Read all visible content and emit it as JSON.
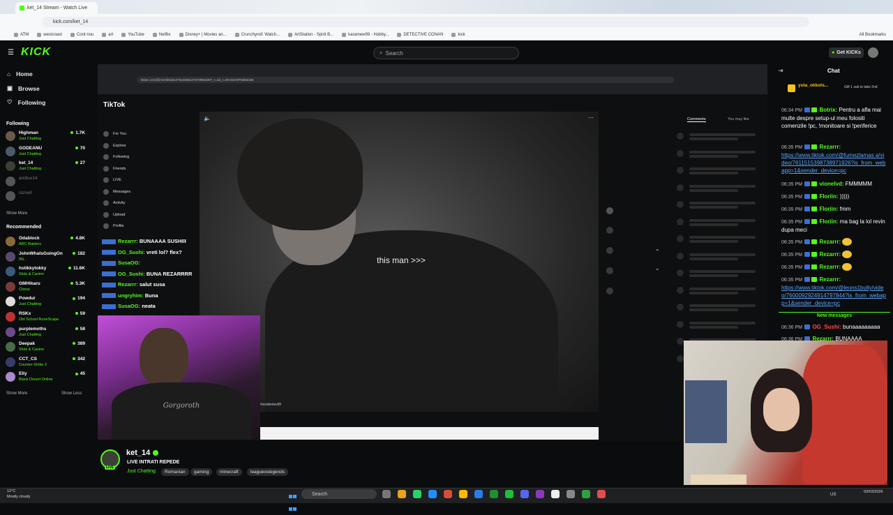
{
  "browser": {
    "tab_title": "ket_14 Stream - Watch Live",
    "url": "kick.com/ket_14",
    "bookmarks": [
      "ATM",
      "westcoast",
      "Cont nou",
      "art",
      "YouTube",
      "Netflix",
      "Disney+ | Movies an...",
      "Crunchyroll: Watch...",
      "ArtStation - Spirit B...",
      "karamew99 - Hobby...",
      "DETECTIVE CONAN",
      "kick"
    ],
    "all_bookmarks": "All Bookmarks"
  },
  "header": {
    "logo": "KICK",
    "search_placeholder": "Search",
    "get_kicks": "Get KICKs"
  },
  "sidebar": {
    "nav": [
      "Home",
      "Browse",
      "Following"
    ],
    "following_title": "Following",
    "following": [
      {
        "name": "Highman",
        "category": "Just Chatting",
        "viewers": "1.7K"
      },
      {
        "name": "GODEANU",
        "category": "Just Chatting",
        "viewers": "70"
      },
      {
        "name": "ket_14",
        "category": "Just Chatting",
        "viewers": "27"
      },
      {
        "name": "andiuu14",
        "category": "",
        "viewers": ""
      },
      {
        "name": "razvell",
        "category": "",
        "viewers": ""
      }
    ],
    "show_more_1": "Show More",
    "recommended_title": "Recommended",
    "recommended": [
      {
        "name": "Odablock",
        "category": "ARC Raiders",
        "viewers": "4.8K"
      },
      {
        "name": "JohnWhatsGoingOn",
        "category": "IRL",
        "viewers": "182"
      },
      {
        "name": "hstikkytokky",
        "category": "Slots & Casino",
        "viewers": "11.6K"
      },
      {
        "name": "GMHikaru",
        "category": "Chess",
        "viewers": "5.3K"
      },
      {
        "name": "Powdur",
        "category": "Just Chatting",
        "viewers": "194"
      },
      {
        "name": "RSKx",
        "category": "Old School RuneScape",
        "viewers": "59"
      },
      {
        "name": "purplemoths",
        "category": "Just Chatting",
        "viewers": "58"
      },
      {
        "name": "Deepak",
        "category": "Slots & Casino",
        "viewers": "389"
      },
      {
        "name": "CCT_CS",
        "category": "Counter-Strike 2",
        "viewers": "342"
      },
      {
        "name": "Elly",
        "category": "Black Desert Online",
        "viewers": "45"
      }
    ],
    "show_more_2": "Show More",
    "show_less": "Show Less"
  },
  "stream": {
    "inner_url": "tiktok.com/@irisrelli/video/7612658147579993109?_r=1&_t=ZN-94OSPNdk6cDE",
    "tiktok_logo": "TikTok",
    "tiktok_nav": [
      "For You",
      "Explore",
      "Following",
      "Friends",
      "LIVE",
      "Messages",
      "Activity",
      "Upload",
      "Profile"
    ],
    "caption": "this man >>>",
    "video_tag": "#residentevil9",
    "comments_tab": "Comments",
    "you_may_like": "You may like",
    "overlay_chat": [
      {
        "user": "Rezarrr:",
        "msg": "BUNAAAA SUSHIII"
      },
      {
        "user": "OG_Sushi:",
        "msg": "vreti lol? flex?"
      },
      {
        "user": "SusaOG:",
        "msg": ""
      },
      {
        "user": "OG_Sushi:",
        "msg": "BUNA REZARRRR"
      },
      {
        "user": "Rezarrr:",
        "msg": "salut susa"
      },
      {
        "user": "ungryhim:",
        "msg": "Buna"
      },
      {
        "user": "SusaOG:",
        "msg": "neata"
      }
    ],
    "cam_shirt": "Gorgoroth"
  },
  "stream_info": {
    "name": "ket_14",
    "title": "LIVE INTRATI REPEDE",
    "category": "Just Chatting",
    "tags": [
      "Romanian",
      "gaming",
      "minecraft",
      "leagueoslegends"
    ],
    "live_badge": "LIVE"
  },
  "chat": {
    "title": "Chat",
    "pinned_user": "yuta_okkots...",
    "pinned_text": "Gift 1 sub to take 2nd",
    "messages": [
      {
        "time": "06:34 PM",
        "user": "Botrix:",
        "text": "Pentru a afla mai multe despre setup-ul meu folositi comenzile !pc, !monitoare si !periferice",
        "link": "",
        "color": "#53fc18"
      },
      {
        "time": "06:35 PM",
        "user": "Rezarrr:",
        "text": "",
        "link": "https://www.tiktok.com/@fumezlamas a/video/7611515398738971926?is_from_webapp=1&sender_device=pc",
        "color": "#53fc18"
      },
      {
        "time": "06:35 PM",
        "user": "vionelvd:",
        "text": "FMMMMM",
        "link": "",
        "color": "#53fc18"
      },
      {
        "time": "06:35 PM",
        "user": "Floriin:",
        "text": ")))))",
        "link": "",
        "color": "#53fc18"
      },
      {
        "time": "06:35 PM",
        "user": "Floriin:",
        "text": "fmm",
        "link": "",
        "color": "#53fc18"
      },
      {
        "time": "06:35 PM",
        "user": "Floriin:",
        "text": "ma bag la lol revin dupa meci",
        "link": "",
        "color": "#53fc18"
      },
      {
        "time": "06:35 PM",
        "user": "Rezarrr:",
        "text": "",
        "link": "",
        "color": "#53fc18",
        "emote": true
      },
      {
        "time": "06:35 PM",
        "user": "Rezarrr:",
        "text": "",
        "link": "",
        "color": "#53fc18",
        "emote": true
      },
      {
        "time": "06:35 PM",
        "user": "Rezarrr:",
        "text": "",
        "link": "",
        "color": "#53fc18",
        "emote": true
      },
      {
        "time": "06:35 PM",
        "user": "Rezarrr:",
        "text": "",
        "link": "https://www.tiktok.com/@leons1bully/video/7600092924914797844?is_from_webapp=1&sender_device=pc",
        "color": "#53fc18"
      }
    ],
    "new_messages": "New messages",
    "after": [
      {
        "time": "06:36 PM",
        "user": "OG_Sushi:",
        "text": "bunaaaaaaaaa",
        "color": "#ff4b4b"
      },
      {
        "time": "06:36 PM",
        "user": "Rezarrr:",
        "text": "BUNAAAA",
        "color": "#53fc18"
      }
    ]
  },
  "taskbar": {
    "temp": "12°C",
    "weather": "Mostly cloudy",
    "search": "Search",
    "lang": "US",
    "date": "03/03/2026"
  }
}
